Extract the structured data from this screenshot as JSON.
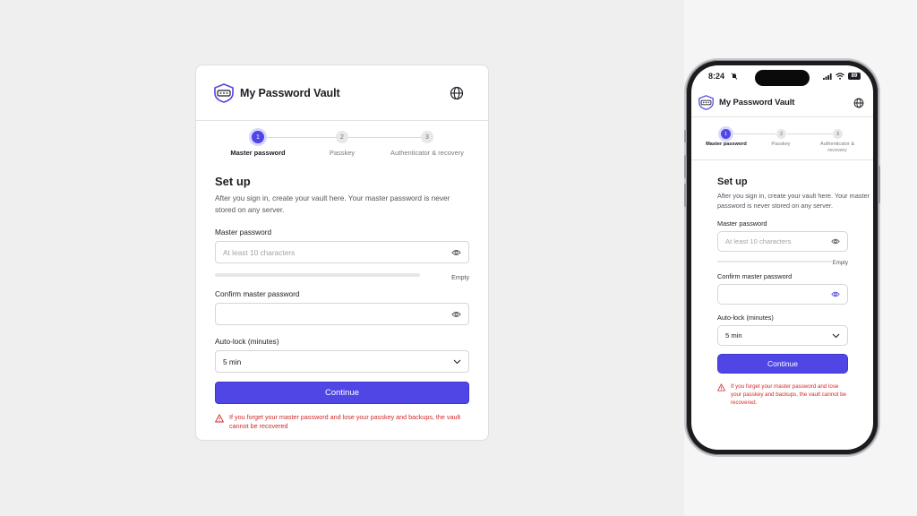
{
  "app": {
    "name": "My Password Vault"
  },
  "steps": [
    {
      "number": "1",
      "label": "Master password",
      "active": true
    },
    {
      "number": "2",
      "label": "Passkey",
      "active": false
    },
    {
      "number": "3",
      "label": "Authenticator & recovery",
      "active": false
    }
  ],
  "mobile_steps": [
    {
      "label": "Master password"
    },
    {
      "label": "Passkey"
    },
    {
      "label": "Authenticator &\nrecovery"
    }
  ],
  "form": {
    "title": "Set up",
    "description": "After you sign in, create your vault here. Your master password is never stored on any server.",
    "master_label": "Master password",
    "master_placeholder": "At least 10 characters",
    "strength_text": "Empty",
    "strength_level": 0,
    "confirm_label": "Confirm master password",
    "confirm_value": "",
    "autolock_label": "Auto-lock (minutes)",
    "autolock_value": "5 min",
    "continue_label": "Continue",
    "warning_text": "If you forget your master password and lose your passkey and backups, the vault cannot be recovered"
  },
  "mobile_form": {
    "warning_text": "If you forget your master password and lose your passkey and backups, the vault cannot be recovered."
  },
  "status_bar": {
    "time": "8:24",
    "battery": "89"
  },
  "colors": {
    "accent": "#4f46e5",
    "danger": "#d12a2a"
  },
  "icons": [
    "vault-logo-icon",
    "globe-icon",
    "eye-icon",
    "chevron-down-icon",
    "warning-icon"
  ]
}
